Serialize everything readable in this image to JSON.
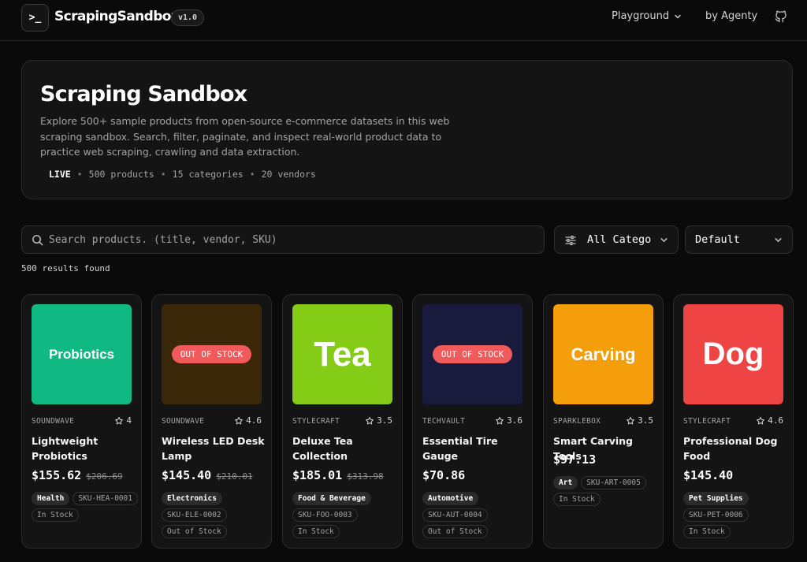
{
  "header": {
    "logo_glyph": ">_",
    "brand": "ScrapingSandbox",
    "version": "v1.0",
    "nav_playground": "Playground",
    "nav_agenty": "by Agenty",
    "github_icon": "github-icon"
  },
  "hero": {
    "title": "Scraping Sandbox",
    "description": "Explore 500+ sample products from open-source e-commerce datasets in this web scraping sandbox. Search, filter, paginate, and inspect real-world product data to practice web scraping, crawling and data extraction.",
    "live": "LIVE",
    "products": "500 products",
    "categories": "15 categories",
    "vendors": "20 vendors",
    "separator": "•"
  },
  "controls": {
    "search_placeholder": "Search products. (title, vendor, SKU)",
    "category_value": "All Categories",
    "sort_value": "Default",
    "results": "500 results found"
  },
  "products": [
    {
      "thumb_text": "Probiotics",
      "thumb_color": "#10b981",
      "out_of_stock_label": "",
      "vendor": "SOUNDWAVE",
      "rating": "4",
      "title": "Lightweight Probiotics",
      "price": "$155.62",
      "old_price": "$206.69",
      "category": "Health",
      "sku": "SKU-HEA-0001",
      "stock": "In Stock"
    },
    {
      "thumb_text": "",
      "thumb_color": "#6b4a10",
      "out_of_stock_label": "OUT OF STOCK",
      "vendor": "SOUNDWAVE",
      "rating": "4.6",
      "title": "Wireless LED Desk Lamp",
      "price": "$145.40",
      "old_price": "$210.01",
      "category": "Electronics",
      "sku": "SKU-ELE-0002",
      "stock": "Out of Stock"
    },
    {
      "thumb_text": "Tea",
      "thumb_color": "#84cc16",
      "out_of_stock_label": "",
      "vendor": "STYLECRAFT",
      "rating": "3.5",
      "title": "Deluxe Tea Collection",
      "price": "$185.01",
      "old_price": "$313.98",
      "category": "Food & Beverage",
      "sku": "SKU-FOO-0003",
      "stock": "In Stock"
    },
    {
      "thumb_text": "",
      "thumb_color": "#2e3270",
      "out_of_stock_label": "OUT OF STOCK",
      "vendor": "TECHVAULT",
      "rating": "3.6",
      "title": "Essential Tire Gauge",
      "price": "$70.86",
      "old_price": "",
      "category": "Automotive",
      "sku": "SKU-AUT-0004",
      "stock": "Out of Stock"
    },
    {
      "thumb_text": "Carving",
      "thumb_color": "#f59e0b",
      "out_of_stock_label": "",
      "vendor": "SPARKLEBOX",
      "rating": "3.5",
      "title": "Smart Carving Tools",
      "price": "$97.13",
      "old_price": "",
      "category": "Art",
      "sku": "SKU-ART-0005",
      "stock": "In Stock"
    },
    {
      "thumb_text": "Dog",
      "thumb_color": "#ef4444",
      "out_of_stock_label": "",
      "vendor": "STYLECRAFT",
      "rating": "4.6",
      "title": "Professional Dog Food",
      "price": "$145.40",
      "old_price": "",
      "category": "Pet Supplies",
      "sku": "SKU-PET-0006",
      "stock": "In Stock"
    }
  ]
}
